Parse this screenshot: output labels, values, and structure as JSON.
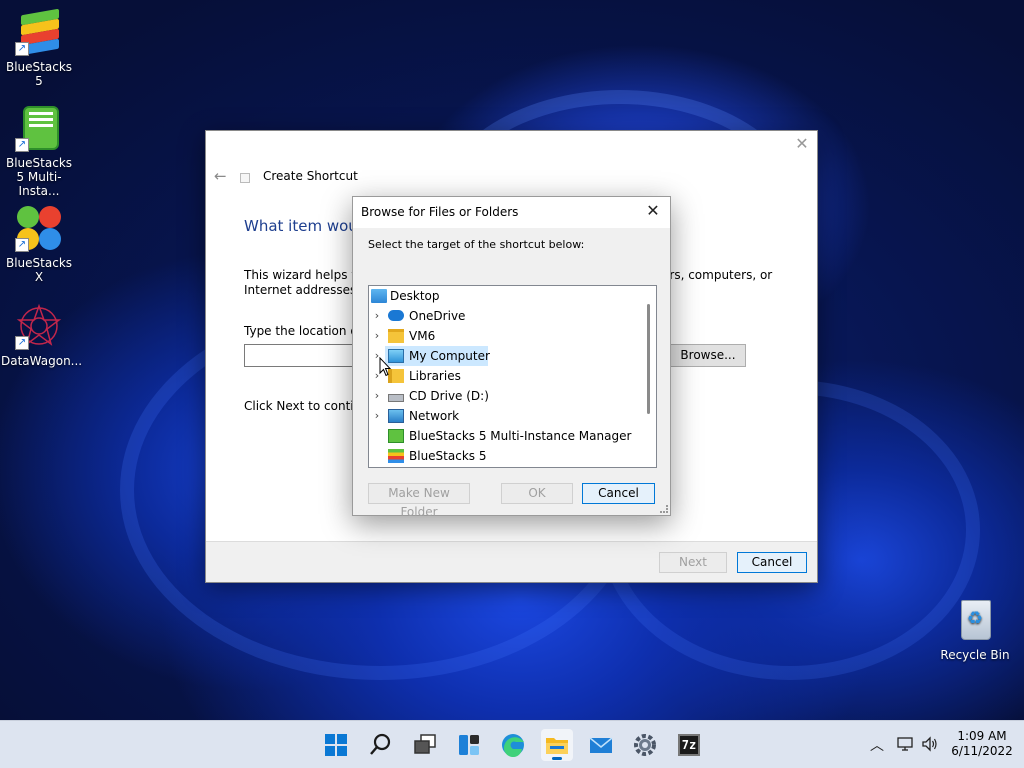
{
  "desktop": {
    "icons": [
      {
        "label": "BlueStacks 5"
      },
      {
        "label": "BlueStacks 5 Multi-Insta..."
      },
      {
        "label": "BlueStacks X"
      },
      {
        "label": "DataWagon..."
      },
      {
        "label": "Recycle Bin"
      }
    ]
  },
  "wizard": {
    "title": "Create Shortcut",
    "heading": "What item woul",
    "desc_line1_left": "This wizard helps you",
    "desc_line1_right": "ers, computers, or",
    "desc_line2": "Internet addresses.",
    "location_label": "Type the location of t",
    "browse_label": "Browse...",
    "continue_text": "Click Next to continu",
    "next_label": "Next",
    "cancel_label": "Cancel"
  },
  "browse": {
    "title": "Browse for Files or Folders",
    "instruction": "Select the target of the shortcut below:",
    "tree": [
      {
        "label": "Desktop",
        "icon": "desktop-folder-icon",
        "expandable": false
      },
      {
        "label": "OneDrive",
        "icon": "cloud-icon",
        "expandable": true
      },
      {
        "label": "VM6",
        "icon": "folder-icon",
        "expandable": true
      },
      {
        "label": "My Computer",
        "icon": "computer-icon",
        "expandable": true,
        "selected": true
      },
      {
        "label": "Libraries",
        "icon": "libraries-icon",
        "expandable": true
      },
      {
        "label": "CD Drive (D:)",
        "icon": "cd-drive-icon",
        "expandable": true
      },
      {
        "label": "Network",
        "icon": "network-icon",
        "expandable": true
      },
      {
        "label": "BlueStacks 5 Multi-Instance Manager",
        "icon": "bluestacks-multi-icon",
        "expandable": false
      },
      {
        "label": "BlueStacks 5",
        "icon": "bluestacks-icon",
        "expandable": false
      }
    ],
    "make_new_folder_label": "Make New Folder",
    "ok_label": "OK",
    "cancel_label": "Cancel"
  },
  "taskbar": {
    "apps": [
      "start-icon",
      "search-icon",
      "task-view-icon",
      "widgets-icon",
      "edge-icon",
      "file-explorer-icon",
      "mail-icon",
      "settings-icon",
      "7zip-icon"
    ],
    "seven_zip_label": "7z",
    "time": "1:09 AM",
    "date": "6/11/2022"
  },
  "colors": {
    "accent": "#0078d7",
    "heading_blue": "#1e3f8f",
    "selection": "#cce8ff"
  }
}
